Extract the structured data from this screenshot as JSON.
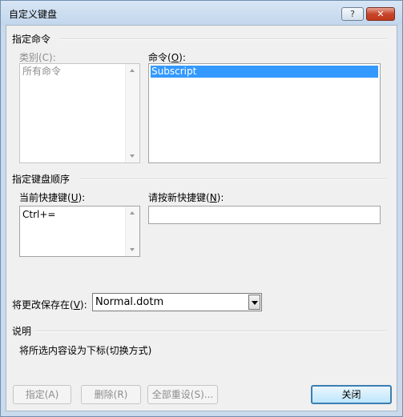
{
  "window": {
    "title": "自定义键盘",
    "help_label": "?",
    "close_label": "✕"
  },
  "specify_command": {
    "section_title": "指定命令",
    "categories_label": "类别(C):",
    "categories": [
      "所有命令"
    ],
    "commands_label_prefix": "命令(",
    "commands_label_key": "O",
    "commands_label_suffix": "):",
    "commands": [
      "Subscript"
    ]
  },
  "key_sequence": {
    "section_title": "指定键盘顺序",
    "current_keys_label_prefix": "当前快捷键(",
    "current_keys_label_key": "U",
    "current_keys_label_suffix": "):",
    "current_keys": [
      "Ctrl+="
    ],
    "new_key_label_prefix": "请按新快捷键(",
    "new_key_label_key": "N",
    "new_key_label_suffix": "):",
    "new_key_value": ""
  },
  "save_changes": {
    "label_prefix": "将更改保存在(",
    "label_key": "V",
    "label_suffix": "):",
    "selected": "Normal.dotm"
  },
  "description": {
    "section_title": "说明",
    "text": "将所选内容设为下标(切换方式)"
  },
  "buttons": {
    "assign": "指定(A)",
    "remove": "删除(R)",
    "reset_all": "全部重设(S)...",
    "close": "关闭"
  },
  "colors": {
    "selection": "#3399ff",
    "title_bar": "#c9daec",
    "close_button": "#c6452b"
  }
}
